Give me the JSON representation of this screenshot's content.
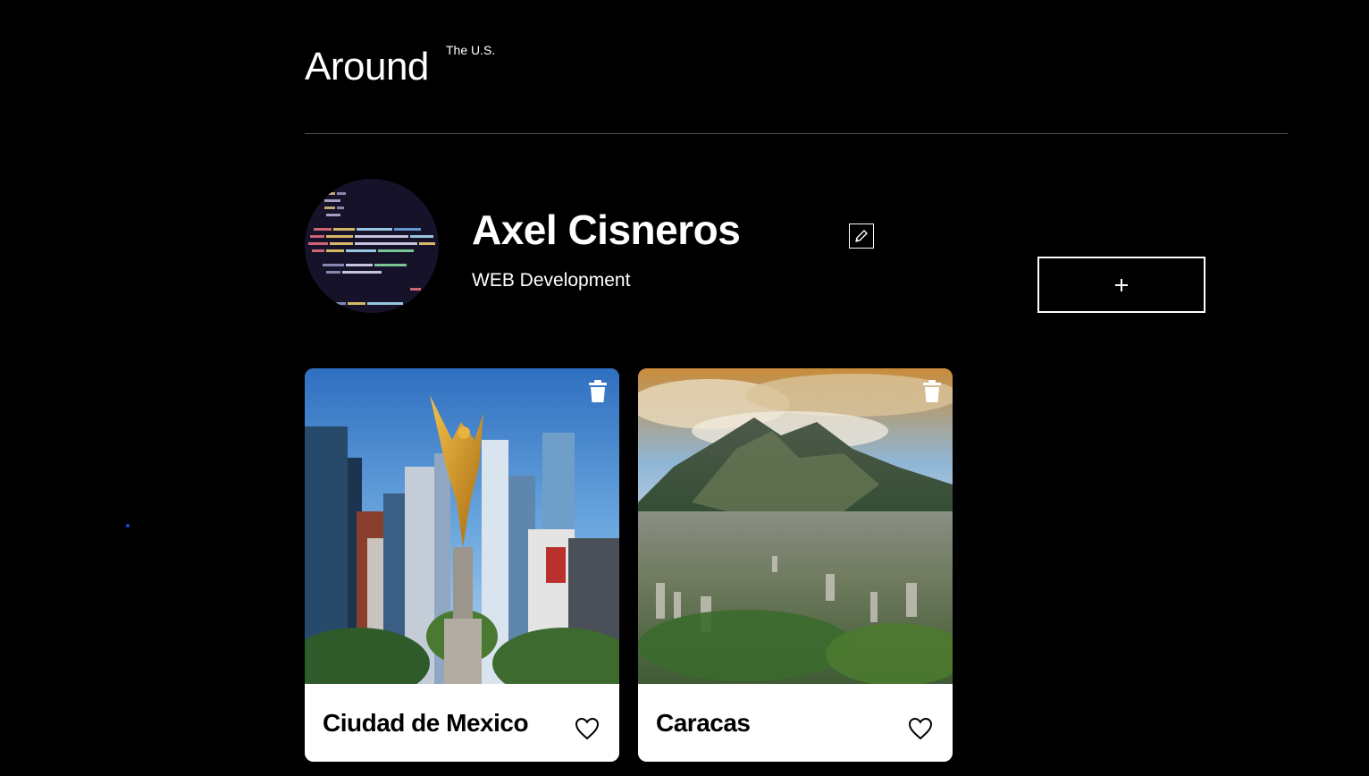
{
  "header": {
    "logo_main": "Around",
    "logo_sup": "The U.S."
  },
  "profile": {
    "name": "Axel Cisneros",
    "about": "WEB Development",
    "edit_icon": "pencil-icon",
    "add_label": "+"
  },
  "cards": [
    {
      "title": "Ciudad de Mexico",
      "image": "mexico-city-angel-photo",
      "delete_icon": "trash-icon",
      "like_icon": "heart-icon"
    },
    {
      "title": "Caracas",
      "image": "caracas-mountain-photo",
      "delete_icon": "trash-icon",
      "like_icon": "heart-icon"
    }
  ],
  "colors": {
    "background": "#000000",
    "text": "#ffffff",
    "card_background": "#ffffff",
    "card_text": "#000000",
    "divider": "#545454",
    "focus_dot": "#1a44e0"
  }
}
